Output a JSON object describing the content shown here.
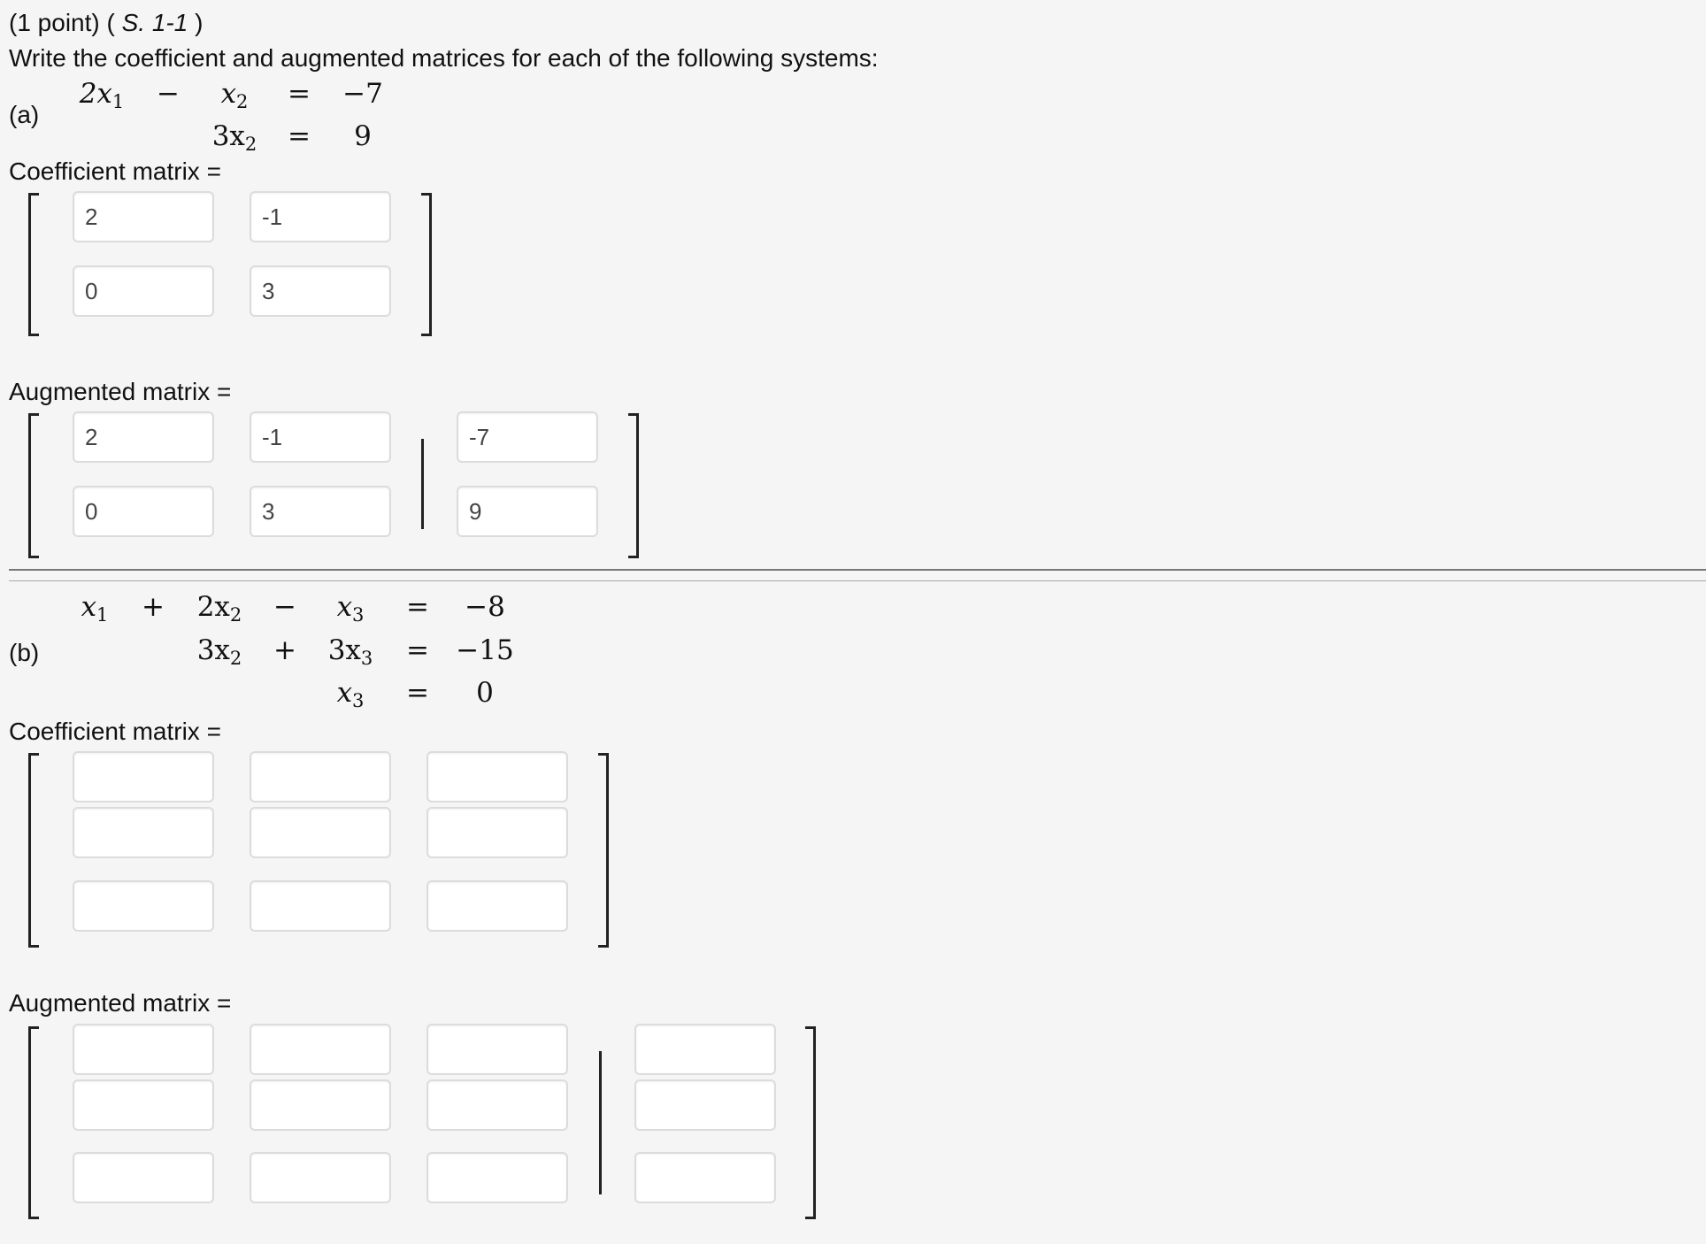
{
  "header": {
    "points": "(1 point) (",
    "ref": "S. 1-1",
    "close_paren": ")",
    "instruction": "Write the coefficient and augmented matrices for each of the following systems:"
  },
  "part_a": {
    "label": "(a)",
    "eq": {
      "r1c1": "2x",
      "r1c1_sub": "1",
      "r1op": "−",
      "r1c2": "x",
      "r1c2_sub": "2",
      "r1eq": "=",
      "r1rhs": "−7",
      "r2c2": "3x",
      "r2c2_sub": "2",
      "r2eq": "=",
      "r2rhs": "9"
    },
    "coef_label": "Coefficient matrix =",
    "aug_label": "Augmented matrix =",
    "coef": [
      [
        "2",
        "-1"
      ],
      [
        "0",
        "3"
      ]
    ],
    "aug": [
      [
        "2",
        "-1",
        "-7"
      ],
      [
        "0",
        "3",
        "9"
      ]
    ]
  },
  "part_b": {
    "label": "(b)",
    "eq": {
      "r1c1": "x",
      "r1c1_sub": "1",
      "r1op1": "+",
      "r1c2": "2x",
      "r1c2_sub": "2",
      "r1op2": "−",
      "r1c3": "x",
      "r1c3_sub": "3",
      "r1eq": "=",
      "r1rhs": "−8",
      "r2c2": "3x",
      "r2c2_sub": "2",
      "r2op2": "+",
      "r2c3": "3x",
      "r2c3_sub": "3",
      "r2eq": "=",
      "r2rhs": "−15",
      "r3c3": "x",
      "r3c3_sub": "3",
      "r3eq": "=",
      "r3rhs": "0"
    },
    "coef_label": "Coefficient matrix =",
    "aug_label": "Augmented matrix =",
    "coef": [
      [
        "",
        "",
        ""
      ],
      [
        "",
        "",
        ""
      ],
      [
        "",
        "",
        ""
      ]
    ],
    "aug": [
      [
        "",
        "",
        "",
        ""
      ],
      [
        "",
        "",
        "",
        ""
      ],
      [
        "",
        "",
        "",
        ""
      ]
    ]
  }
}
